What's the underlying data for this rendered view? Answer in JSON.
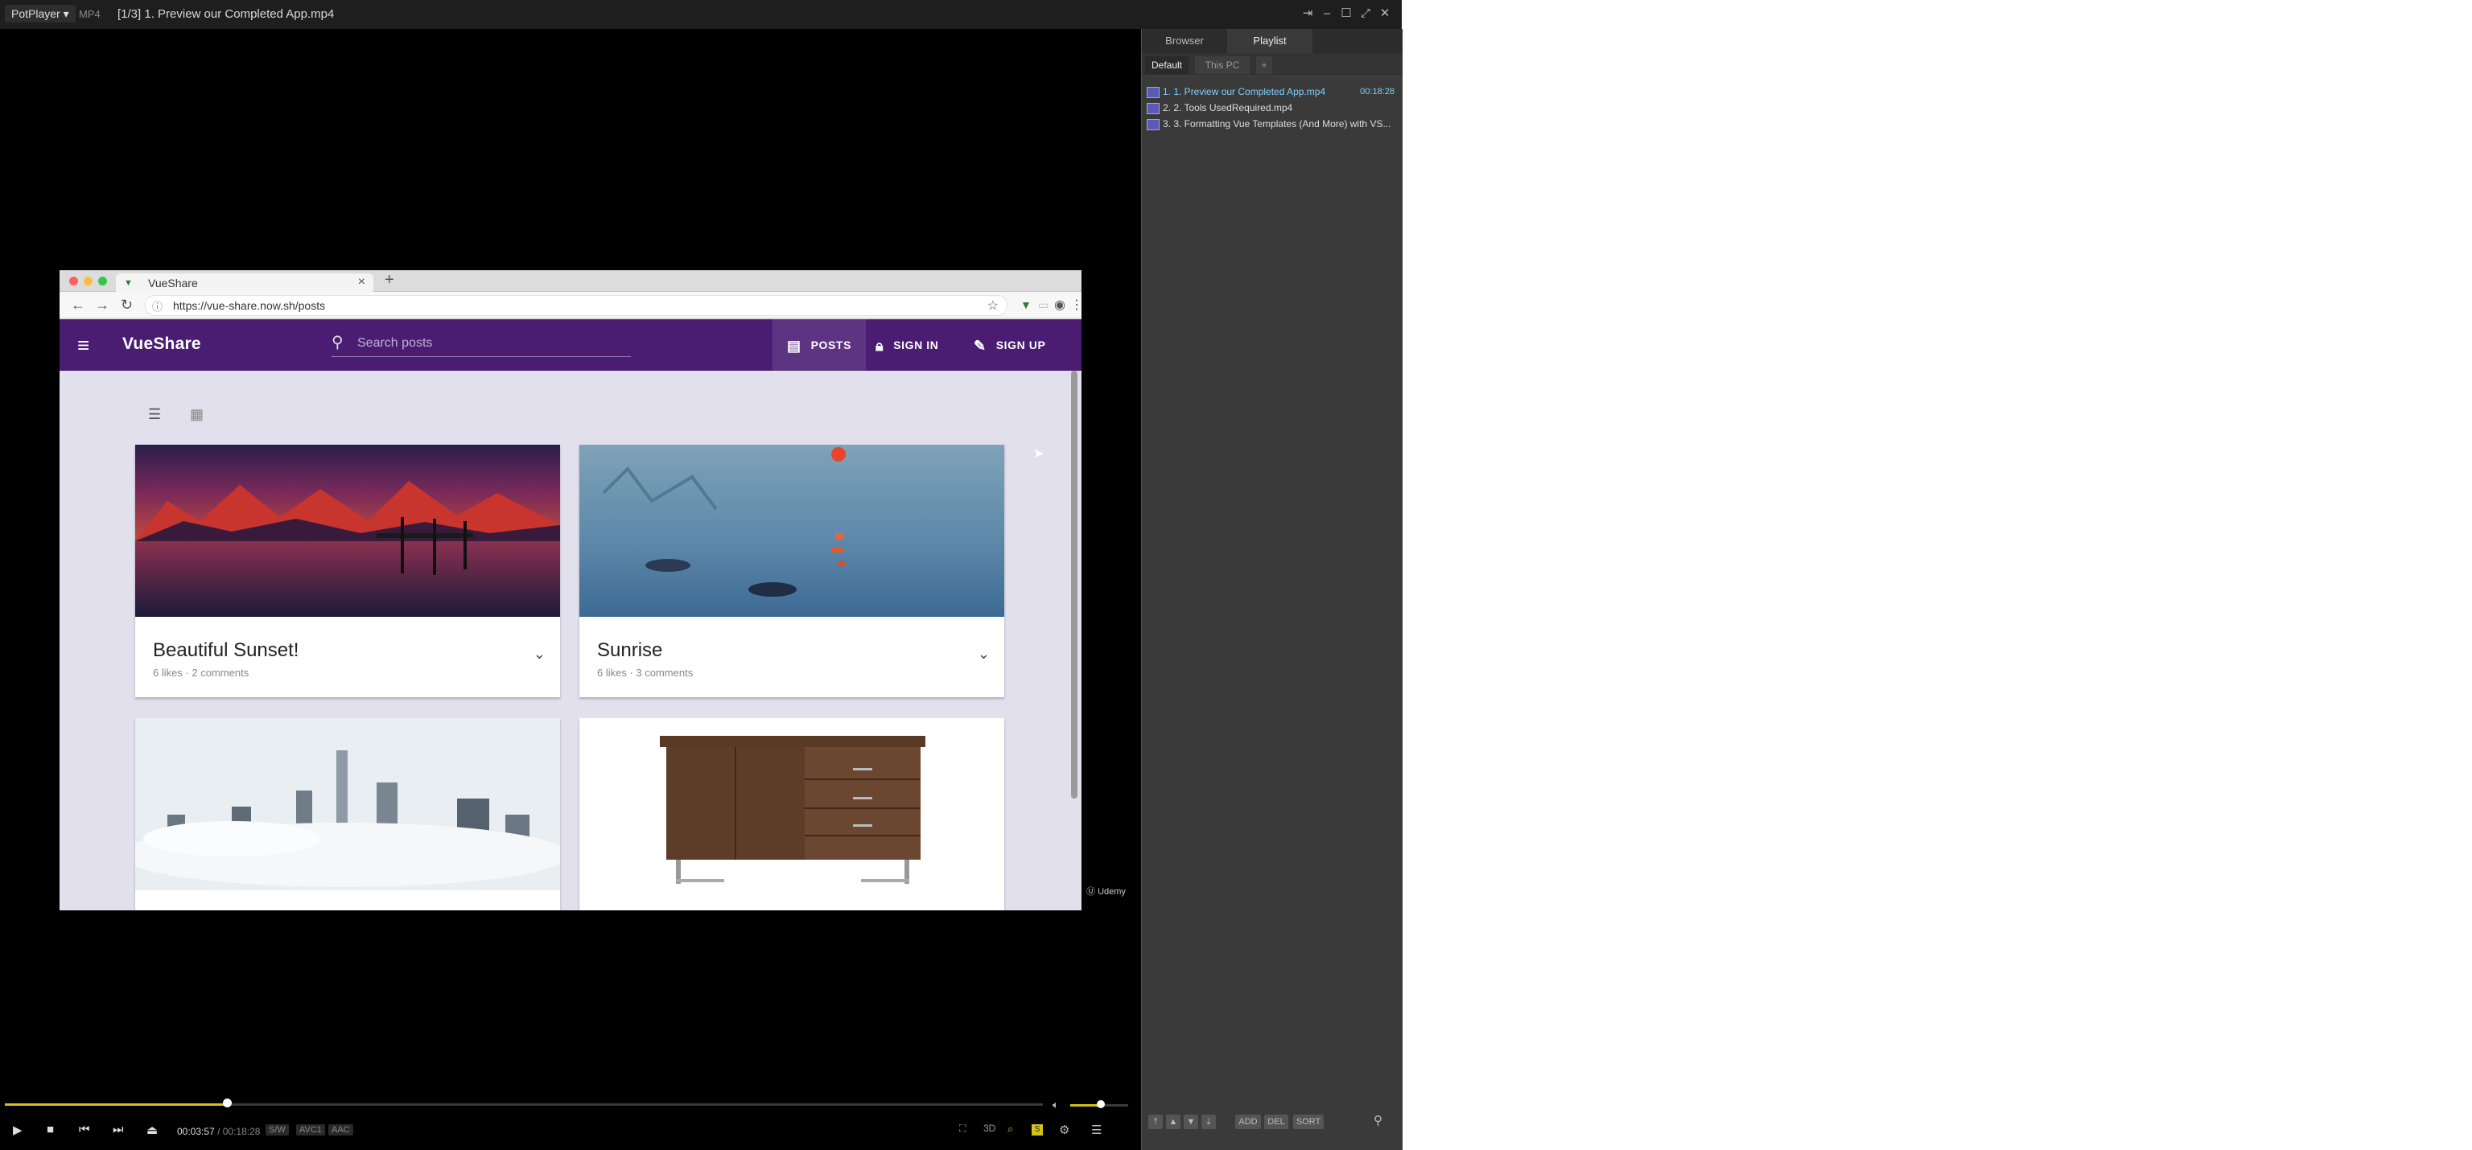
{
  "titlebar": {
    "app": "PotPlayer",
    "format": "MP4",
    "title": "[1/3] 1. Preview our Completed App.mp4",
    "buttons": [
      "pin",
      "minimize",
      "maximize",
      "fullscreen",
      "close"
    ]
  },
  "browser": {
    "tab_title": "VueShare",
    "url": "https://vue-share.now.sh/posts"
  },
  "app": {
    "brand": "VueShare",
    "search_placeholder": "Search posts",
    "nav": {
      "posts": "POSTS",
      "sign_in": "SIGN IN",
      "sign_up": "SIGN UP"
    },
    "posts": [
      {
        "title": "Beautiful Sunset!",
        "meta": "6 likes · 2 comments"
      },
      {
        "title": "Sunrise",
        "meta": "6 likes · 3 comments"
      },
      {
        "title": "",
        "meta": ""
      },
      {
        "title": "",
        "meta": ""
      }
    ]
  },
  "watermark": "Udemy",
  "controls": {
    "current_time": "00:03:57",
    "separator": "/",
    "duration": "00:18:28",
    "tags": [
      "S/W",
      "AVC1",
      "AAC"
    ],
    "progress": 0.214,
    "volume": 0.53
  },
  "panel": {
    "tabs": [
      "Browser",
      "Playlist"
    ],
    "subtabs": [
      "Default",
      "This PC",
      "+"
    ],
    "items": [
      {
        "label": "1. 1. Preview our Completed App.mp4",
        "duration": "00:18:28",
        "active": true
      },
      {
        "label": "2. 2. Tools UsedRequired.mp4",
        "duration": "",
        "active": false
      },
      {
        "label": "3. 3. Formatting Vue Templates (And More) with VS...",
        "duration": "",
        "active": false
      }
    ],
    "bottom_buttons": [
      "ADD",
      "DEL",
      "SORT"
    ]
  }
}
